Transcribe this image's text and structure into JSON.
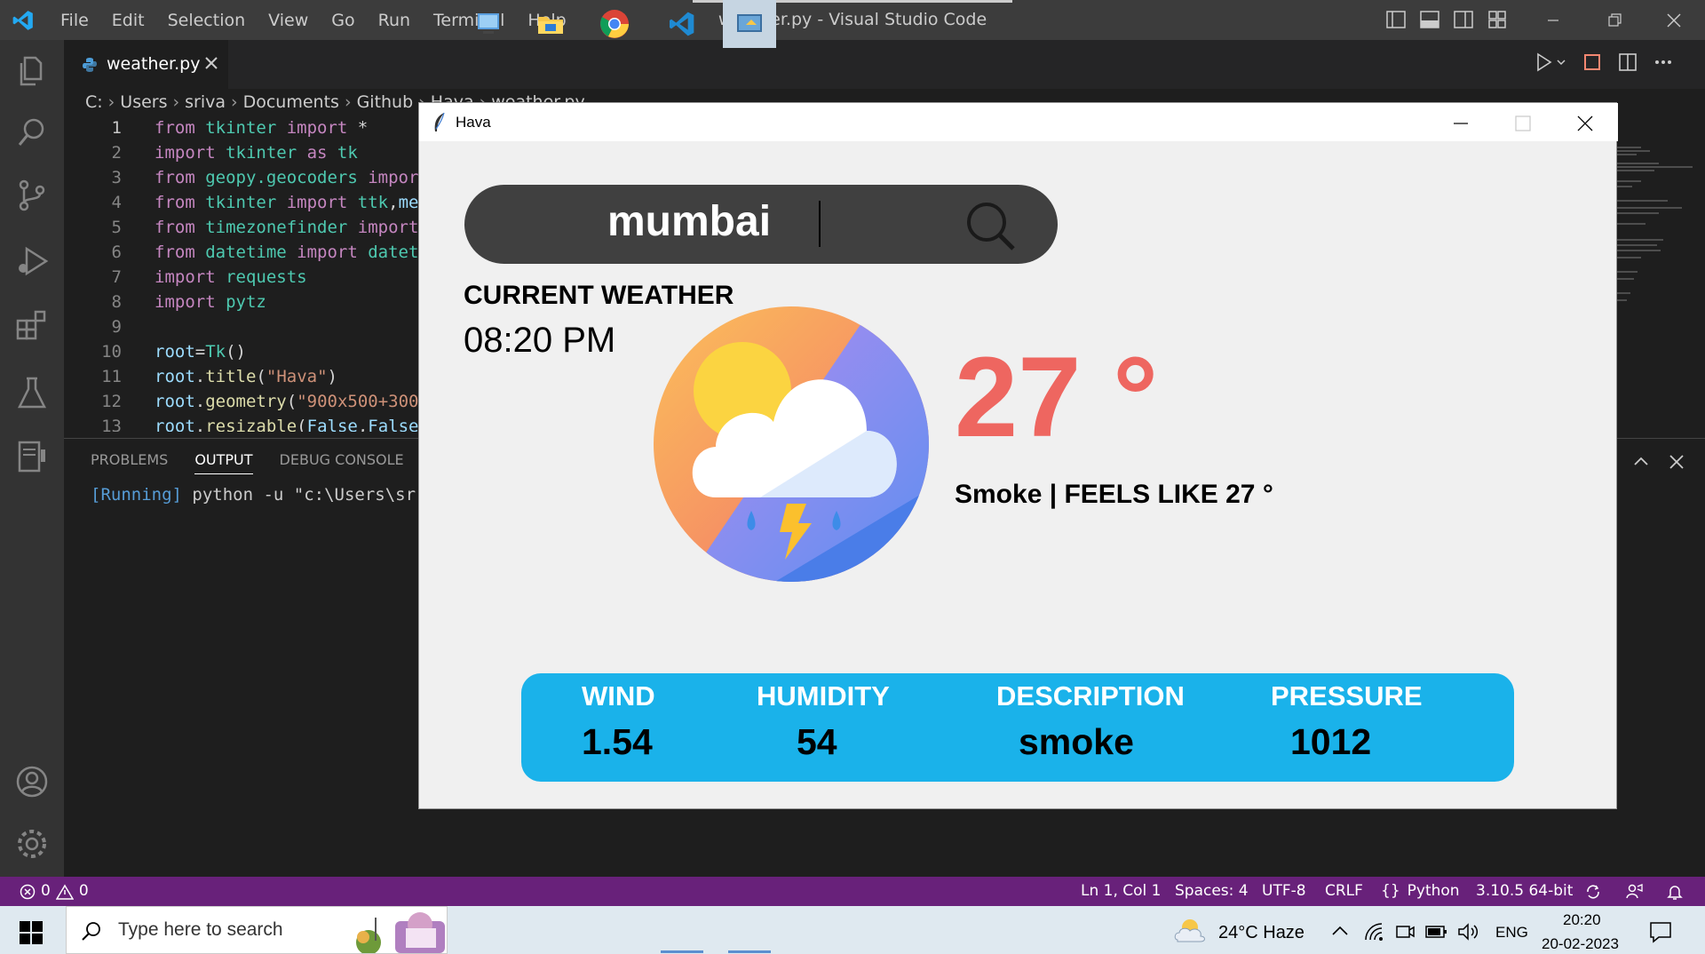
{
  "vscode": {
    "menu": [
      "File",
      "Edit",
      "Selection",
      "View",
      "Go",
      "Run",
      "Terminal",
      "Help"
    ],
    "window_title": "weather.py - Visual Studio Code",
    "tab_label": "weather.py",
    "breadcrumb": [
      "C:",
      "Users",
      "sriva",
      "Documents",
      "Github",
      "Hava",
      "weather.py"
    ],
    "code_lines": [
      {
        "n": "1",
        "parts": [
          [
            "kw",
            "from "
          ],
          [
            "mod",
            "tkinter "
          ],
          [
            "kw",
            "import "
          ],
          [
            "plain",
            "*"
          ]
        ]
      },
      {
        "n": "2",
        "parts": [
          [
            "kw",
            "import "
          ],
          [
            "mod",
            "tkinter "
          ],
          [
            "kw",
            "as "
          ],
          [
            "mod",
            "tk"
          ]
        ]
      },
      {
        "n": "3",
        "parts": [
          [
            "kw",
            "from "
          ],
          [
            "mod",
            "geopy.geocoders "
          ],
          [
            "kw",
            "impor"
          ]
        ]
      },
      {
        "n": "4",
        "parts": [
          [
            "kw",
            "from "
          ],
          [
            "mod",
            "tkinter "
          ],
          [
            "kw",
            "import "
          ],
          [
            "mod",
            "ttk"
          ],
          [
            "plain",
            ","
          ],
          [
            "var",
            "me"
          ]
        ]
      },
      {
        "n": "5",
        "parts": [
          [
            "kw",
            "from "
          ],
          [
            "mod",
            "timezonefinder "
          ],
          [
            "kw",
            "import"
          ]
        ]
      },
      {
        "n": "6",
        "parts": [
          [
            "kw",
            "from "
          ],
          [
            "mod",
            "datetime "
          ],
          [
            "kw",
            "import "
          ],
          [
            "mod",
            "datet"
          ]
        ]
      },
      {
        "n": "7",
        "parts": [
          [
            "kw",
            "import "
          ],
          [
            "mod",
            "requests"
          ]
        ]
      },
      {
        "n": "8",
        "parts": [
          [
            "kw",
            "import "
          ],
          [
            "mod",
            "pytz"
          ]
        ]
      },
      {
        "n": "9",
        "parts": []
      },
      {
        "n": "10",
        "parts": [
          [
            "var",
            "root"
          ],
          [
            "plain",
            "="
          ],
          [
            "mod",
            "Tk"
          ],
          [
            "plain",
            "()"
          ]
        ]
      },
      {
        "n": "11",
        "parts": [
          [
            "var",
            "root"
          ],
          [
            "plain",
            "."
          ],
          [
            "fn",
            "title"
          ],
          [
            "plain",
            "("
          ],
          [
            "str",
            "\"Hava\""
          ],
          [
            "plain",
            ")"
          ]
        ]
      },
      {
        "n": "12",
        "parts": [
          [
            "var",
            "root"
          ],
          [
            "plain",
            "."
          ],
          [
            "fn",
            "geometry"
          ],
          [
            "plain",
            "("
          ],
          [
            "str",
            "\"900x500+300"
          ]
        ]
      },
      {
        "n": "13",
        "parts": [
          [
            "var",
            "root"
          ],
          [
            "plain",
            "."
          ],
          [
            "fn",
            "resizable"
          ],
          [
            "plain",
            "("
          ],
          [
            "var",
            "False"
          ],
          [
            "plain",
            ","
          ],
          [
            "var",
            "False"
          ]
        ]
      }
    ],
    "panel_tabs": [
      "PROBLEMS",
      "OUTPUT",
      "DEBUG CONSOLE"
    ],
    "output_running": "[Running]",
    "output_cmd": " python -u \"c:\\Users\\sr",
    "status": {
      "errors": "0",
      "warnings": "0",
      "position": "Ln 1, Col 1",
      "spaces": "Spaces: 4",
      "encoding": "UTF-8",
      "eol": "CRLF",
      "language": "Python",
      "interpreter": "3.10.5 64-bit"
    }
  },
  "app": {
    "title": "Hava",
    "search_value": "mumbai",
    "current_weather_label": "CURRENT WEATHER",
    "local_time": "08:20 PM",
    "temperature": "27 °",
    "feels_like": "Smoke | FEELS LIKE 27 °",
    "stats": [
      {
        "label": "WIND",
        "value": "1.54"
      },
      {
        "label": "HUMIDITY",
        "value": "54"
      },
      {
        "label": "DESCRIPTION",
        "value": "smoke"
      },
      {
        "label": "PRESSURE",
        "value": "1012"
      }
    ],
    "weather_icon": "thunderstorm-cloud-sun-icon"
  },
  "taskbar": {
    "search_placeholder": "Type here to search",
    "weather": "24°C  Haze",
    "language": "ENG",
    "time": "20:20",
    "date": "20-02-2023"
  },
  "colors": {
    "vscode_titlebar": "#3c3c3c",
    "vscode_statusbar": "#68217a",
    "temperature": "#ee6660",
    "stats_bar": "#1ab2ea",
    "search_bar": "#404040"
  }
}
